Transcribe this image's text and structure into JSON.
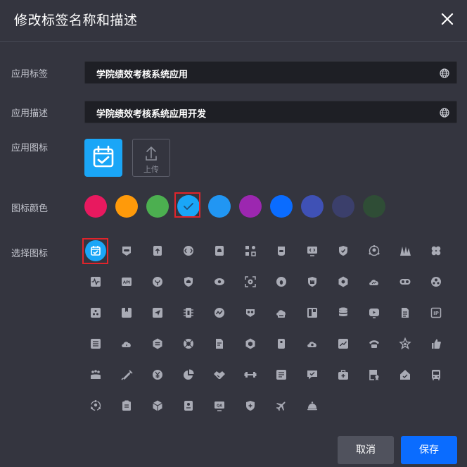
{
  "dialog": {
    "title": "修改标签名称和描述"
  },
  "form": {
    "label_app_tag": "应用标签",
    "app_tag_value": "学院绩效考核系统应用",
    "label_app_desc": "应用描述",
    "app_desc_value": "学院绩效考核系统应用开发",
    "label_app_icon": "应用图标",
    "upload_label": "上传",
    "label_icon_color": "图标颜色",
    "label_choose_icon": "选择图标"
  },
  "colors": {
    "swatches": [
      "#e8195f",
      "#ff9a0a",
      "#4caf50",
      "#1aa6f7",
      "#2196f3",
      "#9c27b0",
      "#0a6cff",
      "#3f51b5",
      "#3b3f6b",
      "#2f4d36"
    ],
    "selected_swatch": "#1aa6f7",
    "accent": "#0a6cff"
  },
  "icon_grid": {
    "selected_icon": "calendar-check-icon",
    "icons": [
      "calendar-check-icon",
      "gamepad-badge-icon",
      "upload-box-icon",
      "code-globe-icon",
      "bell-box-icon",
      "scan-grid-icon",
      "robot-icon",
      "code-screen-icon",
      "shield-check-icon",
      "network-person-icon",
      "plants-icon",
      "clover-icon",
      "waveform-icon",
      "api-icon",
      "leaf-icon",
      "home-shield-icon",
      "eye-icon",
      "scan-eye-icon",
      "globe-bug-icon",
      "castle-shield-icon",
      "hexagon-eye-icon",
      "cloud-chart-icon",
      "toggle-pill-icon",
      "team-circle-icon",
      "triangle-box-icon",
      "bookmark-box-icon",
      "send-box-icon",
      "server-chip-icon",
      "activity-circle-icon",
      "glasses-badge-icon",
      "cloud-box-icon",
      "layout-icon",
      "database-icon",
      "play-tv-icon",
      "document-icon",
      "ip-icon",
      "list-box-icon",
      "cloud-drop-icon",
      "swap-hexagon-icon",
      "lifebuoy-icon",
      "document-edit-icon",
      "cube-hexagon-icon",
      "phone-box-icon",
      "cloud-upload-icon",
      "chart-up-icon",
      "phone-ring-icon",
      "star-badge-icon",
      "thumbs-up-icon",
      "group-icon",
      "syringe-icon",
      "yen-icon",
      "pie-chart-icon",
      "handshake-icon",
      "dumbbell-icon",
      "list-doc-icon",
      "chat-check-icon",
      "medical-kit-icon",
      "certificate-icon",
      "home-check-icon",
      "bus-icon",
      "cycle-person-icon",
      "clipboard-icon",
      "package-box-icon",
      "id-card-icon",
      "qa-screen-icon",
      "shield-plus-icon",
      "airplane-icon",
      "service-bell-icon"
    ]
  },
  "footer": {
    "cancel_label": "取消",
    "save_label": "保存"
  }
}
